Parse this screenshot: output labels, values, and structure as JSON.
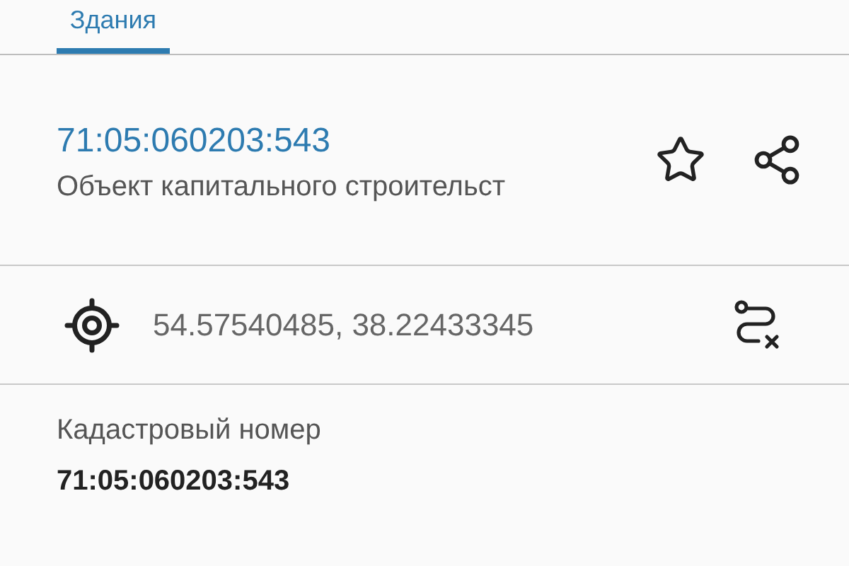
{
  "tabs": [
    {
      "label": "Здания",
      "selected": true
    }
  ],
  "object": {
    "cadastral_number": "71:05:060203:543",
    "type": "Объект капитального строительст",
    "favorite": false
  },
  "location": {
    "coordinates": "54.57540485, 38.22433345"
  },
  "fields": [
    {
      "label": "Кадастровый номер",
      "value": "71:05:060203:543"
    }
  ]
}
